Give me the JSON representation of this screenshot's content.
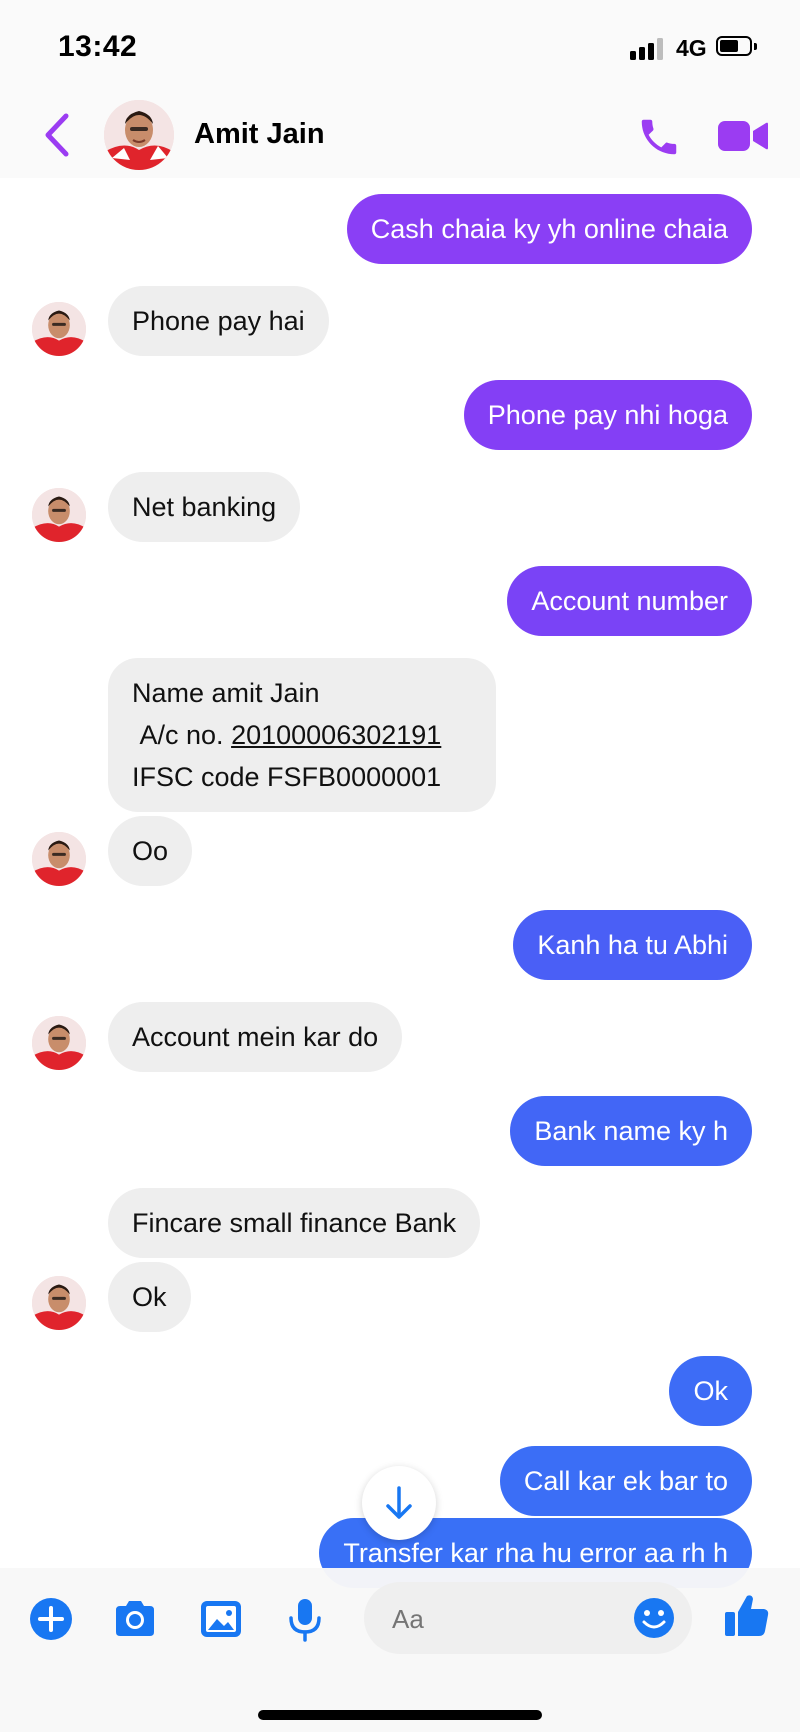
{
  "status_bar": {
    "time": "13:42",
    "network": "4G"
  },
  "header": {
    "contact_name": "Amit Jain"
  },
  "colors": {
    "accent_purple": "#9b3cf2",
    "outgoing_purple": "#8a3ff5",
    "outgoing_violet": "#7047f8",
    "outgoing_blue": "#3d6cf6",
    "composer_blue": "#1877f2",
    "incoming_gray": "#eeeeee"
  },
  "messages": [
    {
      "direction": "outgoing",
      "text": "Cash chaia ky yh online chaia"
    },
    {
      "direction": "incoming",
      "text": "Phone pay hai"
    },
    {
      "direction": "outgoing",
      "text": "Phone pay nhi hoga"
    },
    {
      "direction": "incoming",
      "text": "Net banking"
    },
    {
      "direction": "outgoing",
      "text": "Account number"
    },
    {
      "direction": "incoming",
      "lines": [
        "Name amit Jain",
        "A/c no.",
        "20100006302191",
        "IFSC code FSFB0000001"
      ]
    },
    {
      "direction": "incoming",
      "text": "Oo"
    },
    {
      "direction": "outgoing",
      "text": "Kanh ha tu Abhi"
    },
    {
      "direction": "incoming",
      "text": "Account mein kar do"
    },
    {
      "direction": "outgoing",
      "text": "Bank name ky h"
    },
    {
      "direction": "incoming",
      "text": "Fincare small finance Bank"
    },
    {
      "direction": "incoming",
      "text": "Ok"
    },
    {
      "direction": "outgoing",
      "text": "Ok"
    },
    {
      "direction": "outgoing",
      "text": "Call kar ek bar to"
    },
    {
      "direction": "outgoing",
      "text": "Transfer kar rha hu error aa rh h"
    }
  ],
  "composer": {
    "placeholder": "Aa"
  },
  "icons": {
    "back": "chevron-left-icon",
    "call": "phone-icon",
    "video": "video-camera-icon",
    "scroll": "arrow-down-icon",
    "add": "plus-circle-icon",
    "camera": "camera-icon",
    "gallery": "image-icon",
    "voice": "microphone-icon",
    "emoji": "smiley-icon",
    "like": "thumbs-up-icon"
  }
}
